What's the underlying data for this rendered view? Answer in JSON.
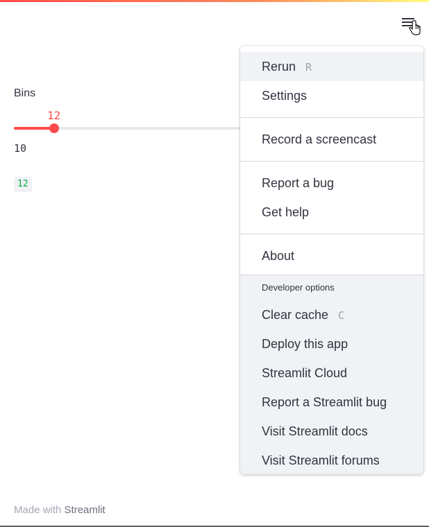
{
  "app": {
    "accent_color": "#ff4b4b",
    "gradient_colors": [
      "#ff4b4b",
      "#fffd80"
    ],
    "menu_icon": "hamburger-icon",
    "cursor_icon": "hand-pointer-icon"
  },
  "slider": {
    "label": "Bins",
    "value": "12",
    "min_label": "10",
    "fill_fraction": 0.17
  },
  "output": {
    "value": "12",
    "color": "#09ab3b"
  },
  "menu": {
    "items": [
      {
        "label": "Rerun",
        "shortcut": "R"
      },
      {
        "label": "Settings"
      },
      {
        "label": "Record a screencast"
      },
      {
        "label": "Report a bug"
      },
      {
        "label": "Get help"
      },
      {
        "label": "About"
      }
    ],
    "developer": {
      "header": "Developer options",
      "items": [
        {
          "label": "Clear cache",
          "shortcut": "C"
        },
        {
          "label": "Deploy this app"
        },
        {
          "label": "Streamlit Cloud"
        },
        {
          "label": "Report a Streamlit bug"
        },
        {
          "label": "Visit Streamlit docs"
        },
        {
          "label": "Visit Streamlit forums"
        }
      ]
    }
  },
  "footer": {
    "prefix": "Made with",
    "link": "Streamlit"
  }
}
